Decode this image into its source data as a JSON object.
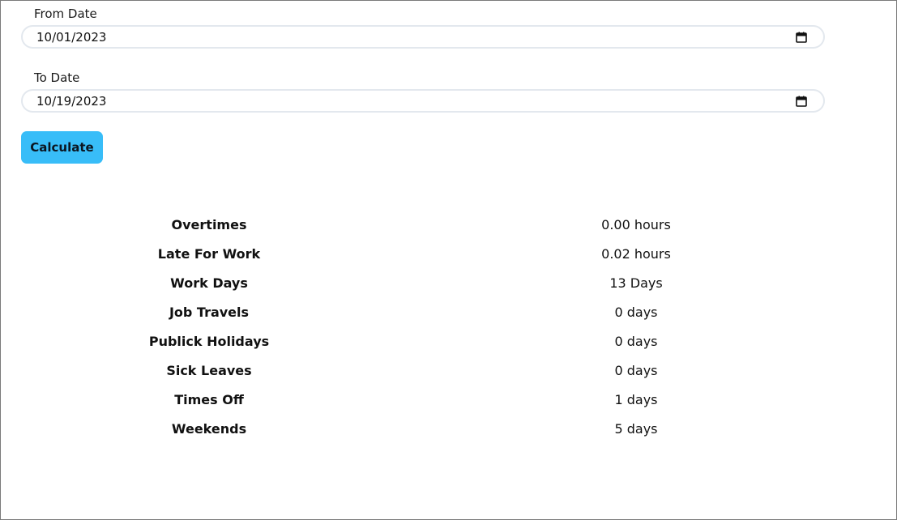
{
  "form": {
    "from_label": "From Date",
    "from_value": "10/01/2023",
    "to_label": "To Date",
    "to_value": "10/19/2023",
    "calculate_label": "Calculate"
  },
  "summary": {
    "rows": [
      {
        "label": "Overtimes",
        "value": "0.00 hours"
      },
      {
        "label": "Late For Work",
        "value": "0.02 hours"
      },
      {
        "label": "Work Days",
        "value": "13 Days"
      },
      {
        "label": "Job Travels",
        "value": "0 days"
      },
      {
        "label": "Publick Holidays",
        "value": "0 days"
      },
      {
        "label": "Sick Leaves",
        "value": "0 days"
      },
      {
        "label": "Times Off",
        "value": "1 days"
      },
      {
        "label": "Weekends",
        "value": "5 days"
      }
    ]
  },
  "colors": {
    "button_bg": "#38bdf8",
    "input_border": "#e3e8ee",
    "frame_border": "#7a7a7a"
  },
  "icons": {
    "date_picker": "calendar-icon"
  }
}
